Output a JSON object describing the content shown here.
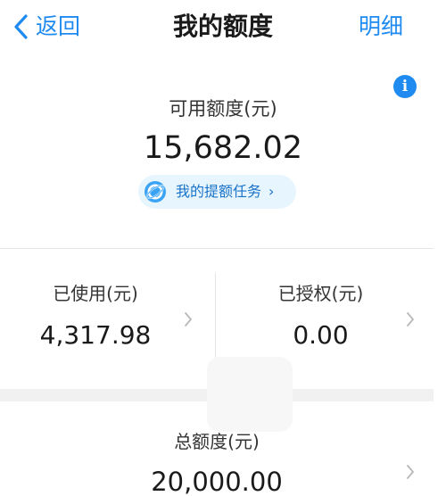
{
  "nav": {
    "back_label": "返回",
    "title": "我的额度",
    "right_label": "明细"
  },
  "available": {
    "label": "可用额度(元)",
    "amount": "15,682.02",
    "task_label": "我的提额任务",
    "task_chevron": "›",
    "info_glyph": "i"
  },
  "stats": {
    "used": {
      "label": "已使用(元)",
      "value": "4,317.98"
    },
    "authorized": {
      "label": "已授权(元)",
      "value": "0.00"
    }
  },
  "total": {
    "label": "总额度(元)",
    "value": "20,000.00"
  },
  "icons": {
    "back": "chevron-left-icon",
    "info": "info-icon",
    "task": "planet-icon",
    "row": "chevron-right-icon"
  },
  "colors": {
    "accent": "#1f8bf0",
    "task_pill_bg": "#e6f5fe",
    "task_text": "#1a73c8",
    "divider": "#e6e6e6",
    "band": "#f1f1f1"
  }
}
